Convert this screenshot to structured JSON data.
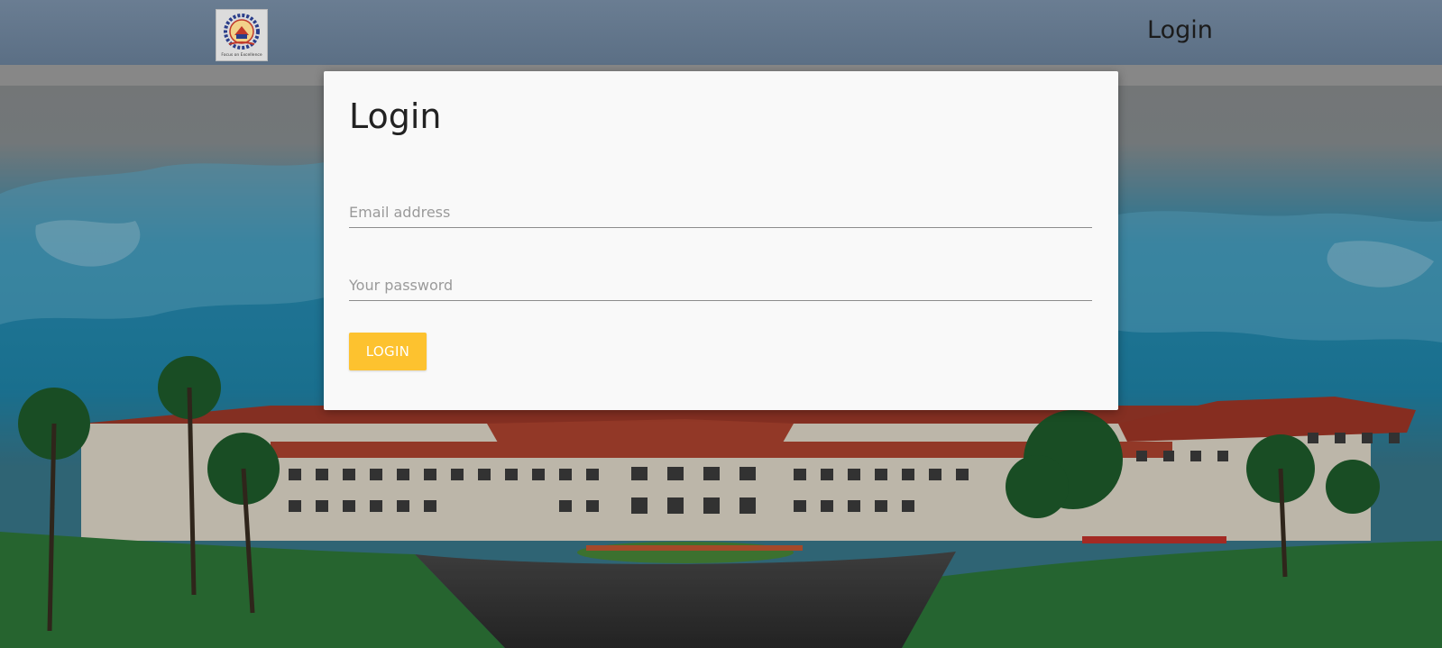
{
  "header": {
    "logo_icon": "college-emblem-icon",
    "logo_motto": "Focus on Excellence",
    "nav_login_label": "Login"
  },
  "login_form": {
    "title": "Login",
    "email_placeholder": "Email address",
    "email_value": "",
    "password_placeholder": "Your password",
    "password_value": "",
    "submit_label": "LOGIN"
  },
  "colors": {
    "header_bg": "#5f7389",
    "card_bg": "#f9f9f9",
    "button_bg": "#fdc22f",
    "button_text": "#ffffff"
  }
}
